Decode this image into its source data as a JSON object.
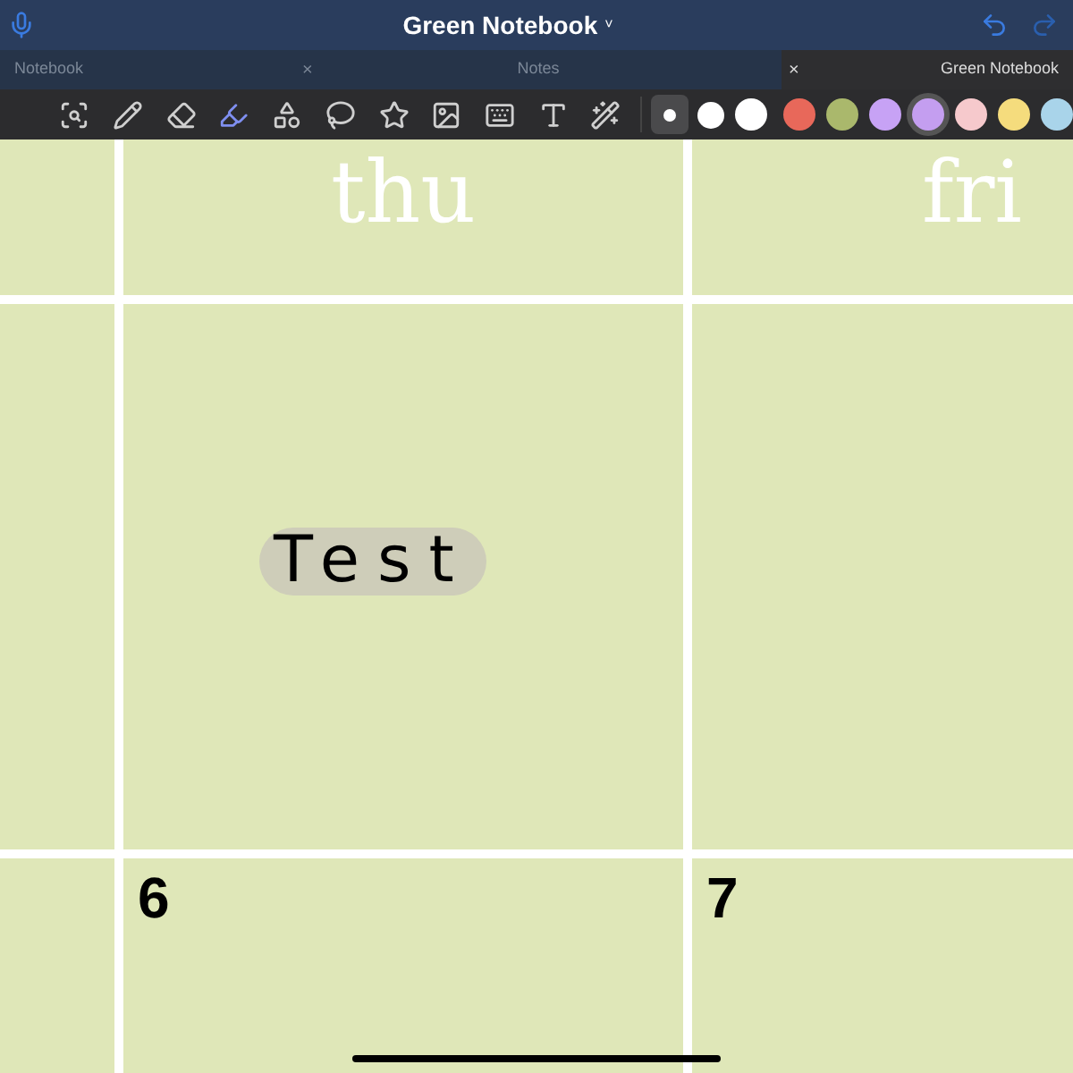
{
  "window": {
    "title": "Green Notebook",
    "title_caret": "˅"
  },
  "tabs": [
    {
      "label": "Notebook",
      "selected": false
    },
    {
      "label": "Notes",
      "selected": false,
      "close": "×"
    },
    {
      "label": "Green Notebook",
      "selected": true,
      "close": "×"
    }
  ],
  "tools": [
    {
      "kind": "zoom",
      "selected": false
    },
    {
      "kind": "pen",
      "selected": false
    },
    {
      "kind": "eraser",
      "selected": false
    },
    {
      "kind": "highlighter",
      "selected": true
    },
    {
      "kind": "shapes",
      "selected": false
    },
    {
      "kind": "lasso",
      "selected": false
    },
    {
      "kind": "sticker",
      "selected": false
    },
    {
      "kind": "image",
      "selected": false
    },
    {
      "kind": "keyboard",
      "selected": false
    },
    {
      "kind": "text",
      "selected": false
    },
    {
      "kind": "laser",
      "selected": false
    }
  ],
  "sizes": [
    {
      "selected": true
    },
    {
      "selected": false
    },
    {
      "selected": false
    }
  ],
  "colors": [
    {
      "color": "#e8685a",
      "selected": false
    },
    {
      "color": "#aab86c",
      "selected": false
    },
    {
      "color": "#c7a2f5",
      "selected": false
    },
    {
      "color": "#c49ef0",
      "selected": true
    },
    {
      "color": "#f6c9cc",
      "selected": false
    },
    {
      "color": "#f5dc7d",
      "selected": false
    },
    {
      "color": "#a9d4ea",
      "selected": false
    }
  ],
  "days": [
    "thu",
    "fri"
  ],
  "note": "Test",
  "dates": [
    "6",
    "7"
  ]
}
